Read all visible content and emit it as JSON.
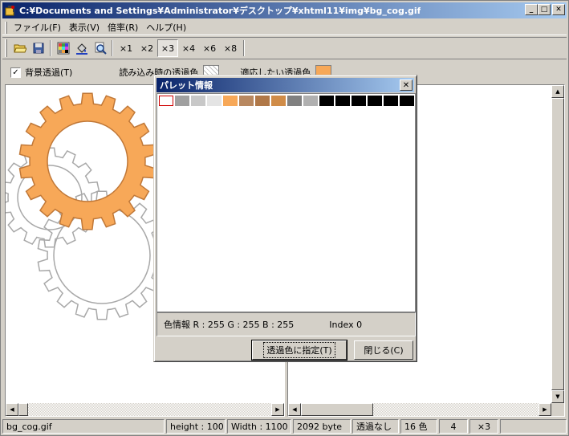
{
  "window": {
    "title": "C:¥Documents and Settings¥Administrator¥デスクトップ¥xhtml11¥img¥bg_cog.gif",
    "minimize_glyph": "_",
    "maximize_glyph": "□",
    "close_glyph": "✕"
  },
  "menu": [
    {
      "label": "ファイル(F)"
    },
    {
      "label": "表示(V)"
    },
    {
      "label": "倍率(R)"
    },
    {
      "label": "ヘルプ(H)"
    }
  ],
  "toolbar": {
    "icons": [
      "open-folder-icon",
      "save-disk-icon",
      "palette-grid-icon",
      "fill-bucket-icon",
      "magnifier-icon"
    ],
    "zoom_buttons": [
      "×1",
      "×2",
      "×3",
      "×4",
      "×6",
      "×8"
    ],
    "zoom_selected": "×3"
  },
  "options": {
    "bg_transparent_checked": "✓",
    "bg_transparent_label": "背景透過(T)",
    "read_trans_label": "読み込み時の透過色",
    "apply_trans_label": "適応したい透過色",
    "apply_trans_color": "#f7a858"
  },
  "colors": {
    "accent": "#0a246a",
    "cog_orange": "#f7a858",
    "cog_gray": "#a8a8a8"
  },
  "dialog": {
    "title": "パレット情報",
    "close_glyph": "✕",
    "palette": [
      "#ffffff",
      "#a0a0a0",
      "#c8c8c8",
      "#e4e4e4",
      "#f7a858",
      "#b88860",
      "#b07848",
      "#d08c48",
      "#808080",
      "#b0b0b0",
      "#000000",
      "#000000",
      "#000000",
      "#000000",
      "#000000",
      "#000000"
    ],
    "info_text": "色情報 R : 255  G : 255  B : 255",
    "index_text": "Index 0",
    "set_trans_button": "透過色に指定(T)",
    "close_button": "閉じる(C)"
  },
  "status": {
    "filename": "bg_cog.gif",
    "height": "height : 100",
    "width": "Width : 1100",
    "size": "2092 byte",
    "transparency": "透過なし",
    "colors": "16 色",
    "bits": "4",
    "zoom": "×3"
  },
  "scroll": {
    "left_glyph": "◀",
    "right_glyph": "▶",
    "up_glyph": "▲",
    "down_glyph": "▼"
  }
}
